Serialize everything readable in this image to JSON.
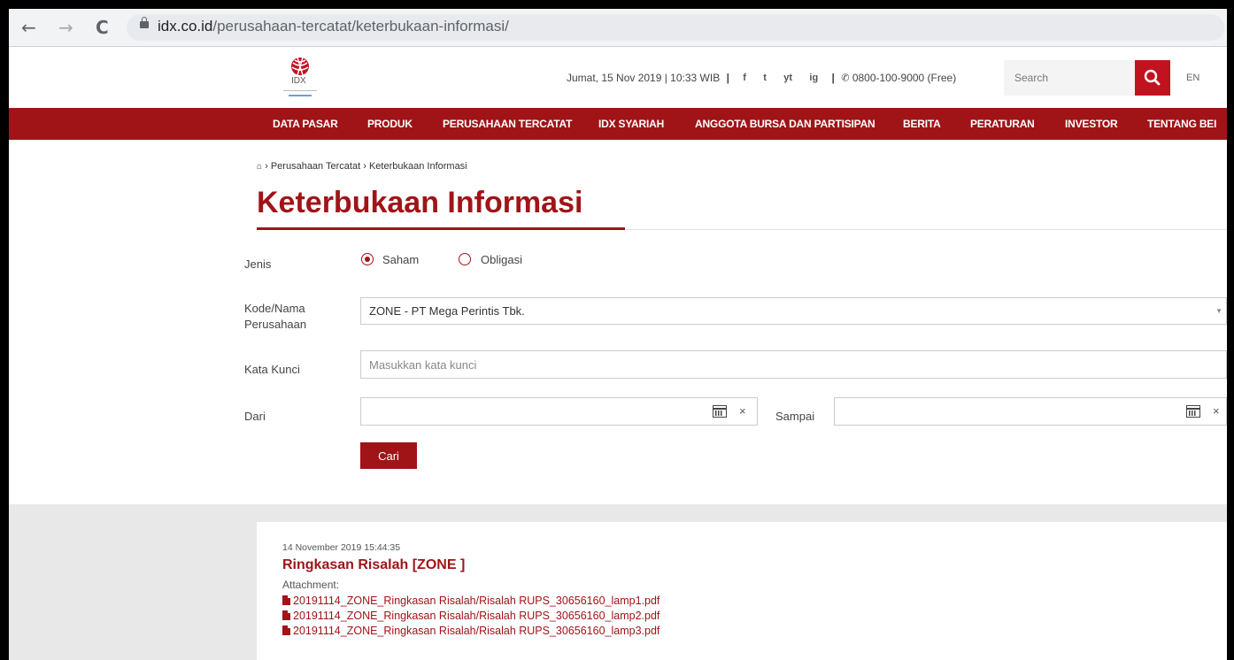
{
  "browser": {
    "url_domain": "idx.co.id",
    "url_path": "/perusahaan-tercatat/keterbukaan-informasi/",
    "back_glyph": "←",
    "forward_glyph": "→",
    "reload_glyph": "C"
  },
  "header": {
    "logo_text": "IDX",
    "datetime": "Jumat, 15 Nov 2019 | 10:33 WIB",
    "social": [
      "f",
      "t",
      "yt",
      "ig"
    ],
    "phone": "0800-100-9000 (Free)",
    "search_placeholder": "Search",
    "lang": "EN"
  },
  "nav": {
    "items": [
      "DATA PASAR",
      "PRODUK",
      "PERUSAHAAN TERCATAT",
      "IDX SYARIAH",
      "ANGGOTA BURSA DAN PARTISIPAN",
      "BERITA",
      "PERATURAN",
      "INVESTOR",
      "TENTANG BEI"
    ]
  },
  "breadcrumb": {
    "sep": "›",
    "items": [
      "Perusahaan Tercatat",
      "Keterbukaan Informasi"
    ]
  },
  "page": {
    "title": "Keterbukaan Informasi"
  },
  "form": {
    "jenis_label": "Jenis",
    "radio_saham": "Saham",
    "radio_obligasi": "Obligasi",
    "kode_label_1": "Kode/Nama",
    "kode_label_2": "Perusahaan",
    "kode_value": "ZONE - PT Mega Perintis Tbk.",
    "kata_label": "Kata Kunci",
    "kata_placeholder": "Masukkan kata kunci",
    "dari_label": "Dari",
    "sampai_label": "Sampai",
    "clear_glyph": "×",
    "submit": "Cari"
  },
  "results": [
    {
      "date": "14 November 2019 15:44:35",
      "title": "Ringkasan Risalah [ZONE ]",
      "attachment_label": "Attachment:",
      "files": [
        "20191114_ZONE_Ringkasan Risalah/Risalah RUPS_30656160_lamp1.pdf",
        "20191114_ZONE_Ringkasan Risalah/Risalah RUPS_30656160_lamp2.pdf",
        "20191114_ZONE_Ringkasan Risalah/Risalah RUPS_30656160_lamp3.pdf"
      ]
    }
  ],
  "colors": {
    "brand_red": "#a01418",
    "search_red": "#c0131f",
    "results_bg": "#e8e8e8"
  }
}
